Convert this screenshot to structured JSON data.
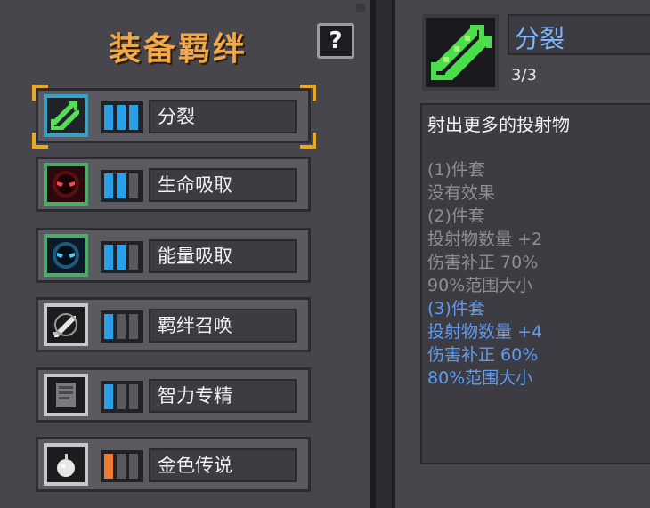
{
  "left": {
    "title": "装备羁绊",
    "help": "?"
  },
  "bonds": [
    {
      "name": "分裂",
      "icon": "split-arrows-icon",
      "frame_color": "#3aa0c0",
      "levels_filled": 3,
      "levels_total": 3,
      "fill_color": "#29a0e8",
      "selected": true
    },
    {
      "name": "生命吸取",
      "icon": "red-eyes-icon",
      "frame_color": "#4caa6a",
      "levels_filled": 2,
      "levels_total": 3,
      "fill_color": "#29a0e8",
      "selected": false
    },
    {
      "name": "能量吸取",
      "icon": "blue-eyes-icon",
      "frame_color": "#4caa6a",
      "levels_filled": 2,
      "levels_total": 3,
      "fill_color": "#29a0e8",
      "selected": false
    },
    {
      "name": "羁绊召唤",
      "icon": "summon-sword-icon",
      "frame_color": "#c8c8c8",
      "levels_filled": 1,
      "levels_total": 3,
      "fill_color": "#29a0e8",
      "selected": false
    },
    {
      "name": "智力专精",
      "icon": "book-icon",
      "frame_color": "#c8c8c8",
      "levels_filled": 1,
      "levels_total": 3,
      "fill_color": "#29a0e8",
      "selected": false
    },
    {
      "name": "金色传说",
      "icon": "white-bomb-icon",
      "frame_color": "#c8c8c8",
      "levels_filled": 1,
      "levels_total": 3,
      "fill_color": "#f07a30",
      "selected": false
    }
  ],
  "detail": {
    "name": "分裂",
    "icon": "split-arrows-icon",
    "progress": "3/3",
    "description": "射出更多的投射物",
    "effects": [
      {
        "text": "(1)件套",
        "state": "dim"
      },
      {
        "text": "没有效果",
        "state": "dim"
      },
      {
        "text": "(2)件套",
        "state": "dim"
      },
      {
        "text": "投射物数量 +2",
        "state": "dim"
      },
      {
        "text": "伤害补正 70%",
        "state": "dim"
      },
      {
        "text": "90%范围大小",
        "state": "dim"
      },
      {
        "text": "(3)件套",
        "state": "active"
      },
      {
        "text": "投射物数量 +4",
        "state": "active"
      },
      {
        "text": "伤害补正 60%",
        "state": "active"
      },
      {
        "text": "80%范围大小",
        "state": "active"
      }
    ]
  }
}
